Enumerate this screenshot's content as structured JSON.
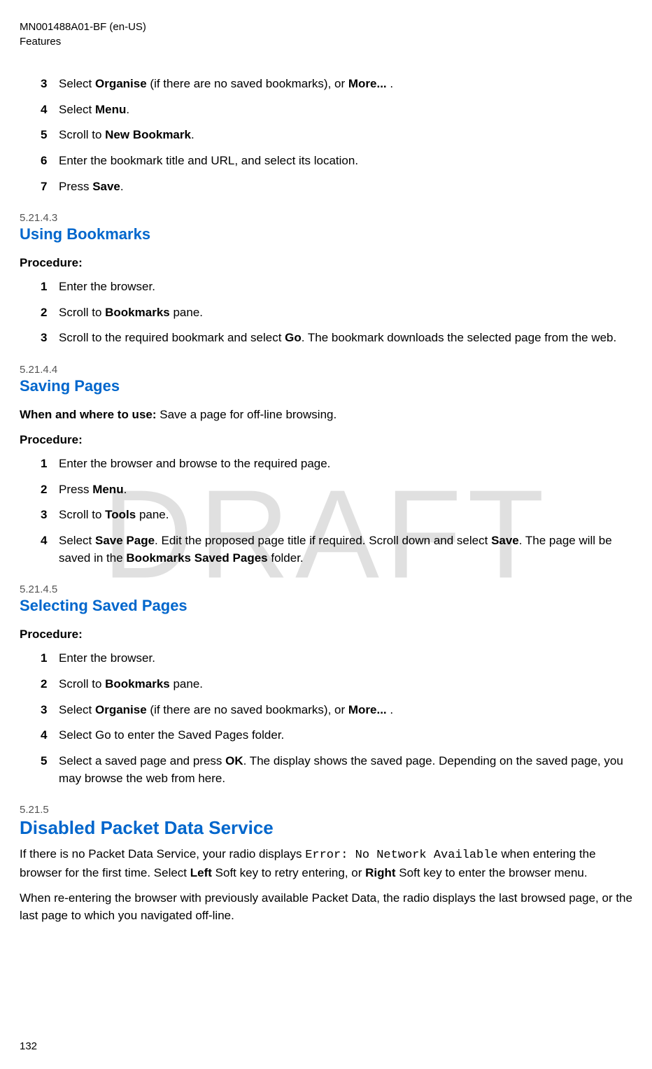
{
  "header": {
    "doc_id": "MN001488A01-BF (en-US)",
    "section": "Features"
  },
  "watermark": "DRAFT",
  "initial_steps": [
    {
      "n": "3",
      "pre": "Select ",
      "b1": "Organise",
      "mid": " (if there are no saved bookmarks), or ",
      "b2": "More...",
      "post": " ."
    },
    {
      "n": "4",
      "pre": "Select ",
      "b1": "Menu",
      "mid": "",
      "b2": "",
      "post": "."
    },
    {
      "n": "5",
      "pre": "Scroll to ",
      "b1": "New Bookmark",
      "mid": "",
      "b2": "",
      "post": "."
    },
    {
      "n": "6",
      "pre": "Enter the bookmark title and URL, and select its location.",
      "b1": "",
      "mid": "",
      "b2": "",
      "post": ""
    },
    {
      "n": "7",
      "pre": "Press ",
      "b1": "Save",
      "mid": "",
      "b2": "",
      "post": "."
    }
  ],
  "s1": {
    "num": "5.21.4.3",
    "title": "Using Bookmarks",
    "proc": "Procedure:",
    "steps": [
      {
        "n": "1",
        "pre": "Enter the browser.",
        "b1": "",
        "mid": "",
        "b2": "",
        "post": ""
      },
      {
        "n": "2",
        "pre": "Scroll to ",
        "b1": "Bookmarks",
        "mid": " pane.",
        "b2": "",
        "post": ""
      },
      {
        "n": "3",
        "pre": "Scroll to the required bookmark and select ",
        "b1": "Go",
        "mid": ". The bookmark downloads the selected page from the web.",
        "b2": "",
        "post": ""
      }
    ]
  },
  "s2": {
    "num": "5.21.4.4",
    "title": "Saving Pages",
    "when_label": "When and where to use: ",
    "when_text": "Save a page for off-line browsing.",
    "proc": "Procedure:",
    "steps": [
      {
        "n": "1",
        "pre": "Enter the browser and browse to the required page.",
        "b1": "",
        "mid": "",
        "b2": "",
        "post": ""
      },
      {
        "n": "2",
        "pre": "Press ",
        "b1": "Menu",
        "mid": ".",
        "b2": "",
        "post": ""
      },
      {
        "n": "3",
        "pre": "Scroll to ",
        "b1": "Tools",
        "mid": " pane.",
        "b2": "",
        "post": ""
      },
      {
        "n": "4",
        "pre": "Select ",
        "b1": "Save Page",
        "mid": ". Edit the proposed page title if required. Scroll down and select ",
        "b2": "Save",
        "post": ". The page will be saved in the ",
        "b3": "Bookmarks Saved Pages",
        "post2": " folder."
      }
    ]
  },
  "s3": {
    "num": "5.21.4.5",
    "title": "Selecting Saved Pages",
    "proc": "Procedure:",
    "steps": [
      {
        "n": "1",
        "pre": "Enter the browser.",
        "b1": "",
        "mid": "",
        "b2": "",
        "post": ""
      },
      {
        "n": "2",
        "pre": "Scroll to ",
        "b1": "Bookmarks",
        "mid": " pane.",
        "b2": "",
        "post": ""
      },
      {
        "n": "3",
        "pre": "Select ",
        "b1": "Organise",
        "mid": " (if there are no saved bookmarks), or ",
        "b2": "More...",
        "post": " ."
      },
      {
        "n": "4",
        "pre": "Select Go to enter the Saved Pages folder.",
        "b1": "",
        "mid": "",
        "b2": "",
        "post": ""
      },
      {
        "n": "5",
        "pre": "Select a saved page and press ",
        "b1": "OK",
        "mid": ". The display shows the saved page. Depending on the saved page, you may browse the web from here.",
        "b2": "",
        "post": ""
      }
    ]
  },
  "s4": {
    "num": "5.21.5",
    "title": "Disabled Packet Data Service",
    "p1_pre": "If there is no Packet Data Service, your radio displays ",
    "p1_mono": "Error: No Network Available",
    "p1_mid": " when entering the browser for the first time. Select ",
    "p1_b1": "Left",
    "p1_mid2": " Soft key to retry entering, or ",
    "p1_b2": "Right",
    "p1_post": " Soft key to enter the browser menu.",
    "p2": "When re-entering the browser with previously available Packet Data, the radio displays the last browsed page, or the last page to which you navigated off-line."
  },
  "page_number": "132"
}
